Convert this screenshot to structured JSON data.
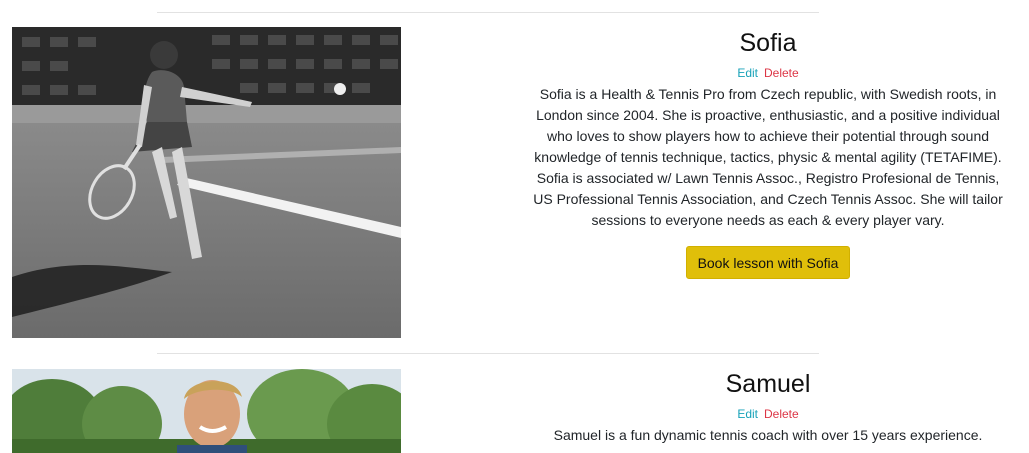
{
  "coaches": [
    {
      "name": "Sofia",
      "edit_label": "Edit",
      "delete_label": "Delete",
      "bio": "Sofia is a Health & Tennis Pro from Czech republic, with Swedish roots, in London since 2004. She is proactive, enthusiastic, and a positive individual who loves to show players how to achieve their potential through sound knowledge of tennis technique, tactics, physic & mental agility (TETAFIME). Sofia is associated w/ Lawn Tennis Assoc., Registro Profesional de Tennis, US Professional Tennis Association, and Czech Tennis Assoc. She will tailor sessions to everyone needs as each & every player vary.",
      "book_label": "Book lesson with Sofia"
    },
    {
      "name": "Samuel",
      "edit_label": "Edit",
      "delete_label": "Delete",
      "bio": "Samuel is a fun dynamic tennis coach with over 15 years experience."
    }
  ],
  "colors": {
    "edit_link": "#17a2b8",
    "delete_link": "#dc3545",
    "book_button": "#e0bf0a"
  }
}
